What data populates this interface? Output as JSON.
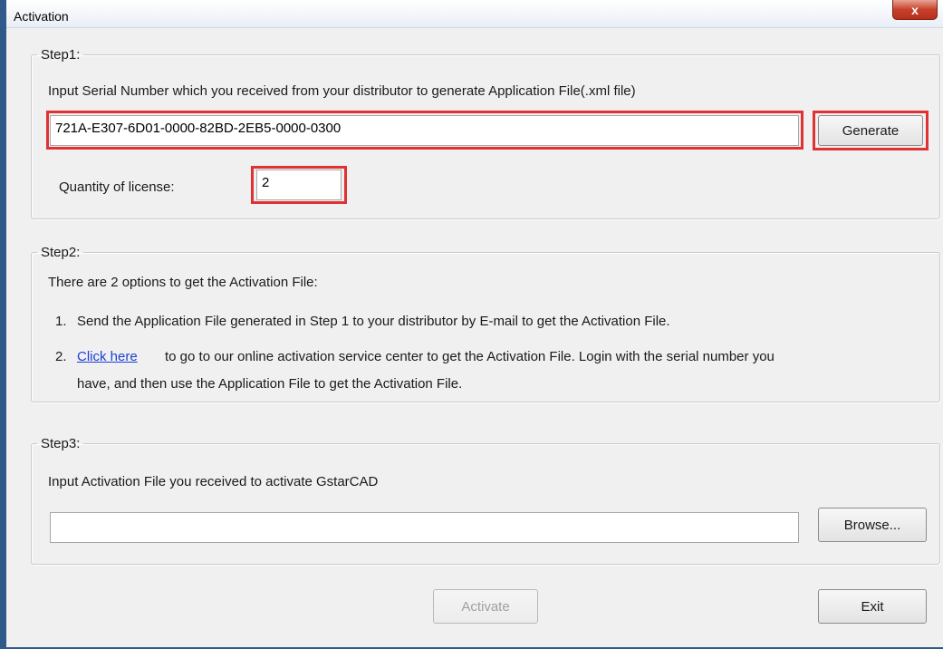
{
  "window": {
    "title": "Activation",
    "close_label": "x"
  },
  "step1": {
    "legend": "Step1:",
    "instruction": "Input Serial Number which you received from your distributor to generate Application File(.xml file)",
    "serial_value": "721A-E307-6D01-0000-82BD-2EB5-0000-0300",
    "generate_label": "Generate",
    "quantity_label": "Quantity of license:",
    "quantity_value": "2"
  },
  "step2": {
    "legend": "Step2:",
    "intro": "There are 2 options to get the Activation File:",
    "option1_num": "1.",
    "option1_text": "Send the Application File generated in Step 1 to your distributor by E-mail to get the Activation File.",
    "option2_num": "2.",
    "option2_link": "Click here",
    "option2_text_line1": "to go to our online activation service center to get the Activation File. Login with the serial number you",
    "option2_text_line2": "have, and then use the Application File to get the Activation File."
  },
  "step3": {
    "legend": "Step3:",
    "instruction": "Input Activation File you received to activate GstarCAD",
    "file_value": "",
    "browse_label": "Browse..."
  },
  "footer": {
    "activate_label": "Activate",
    "exit_label": "Exit"
  },
  "colors": {
    "highlight": "#e03232",
    "link": "#1c3fd6",
    "window_bg": "#f0f0f0",
    "frame": "#2f5a8a"
  }
}
